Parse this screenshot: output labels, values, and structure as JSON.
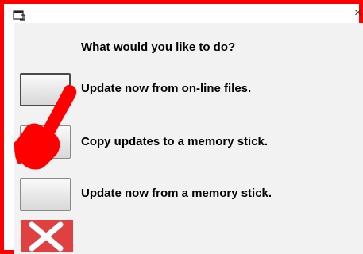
{
  "dialog": {
    "close_glyph": "×",
    "prompt": "What would you like to do?"
  },
  "options": [
    {
      "label": "Update now from on-line files."
    },
    {
      "label": "Copy updates to a memory stick."
    },
    {
      "label": "Update now from a memory stick."
    }
  ],
  "icons": {
    "app": "app-window-icon",
    "close": "close-icon",
    "cancel": "red-x-cancel-icon",
    "pointer": "pointing-hand-icon"
  },
  "colors": {
    "frame_border": "#ff0000",
    "cancel_background": "#e04040",
    "hand": "#ff0000"
  }
}
